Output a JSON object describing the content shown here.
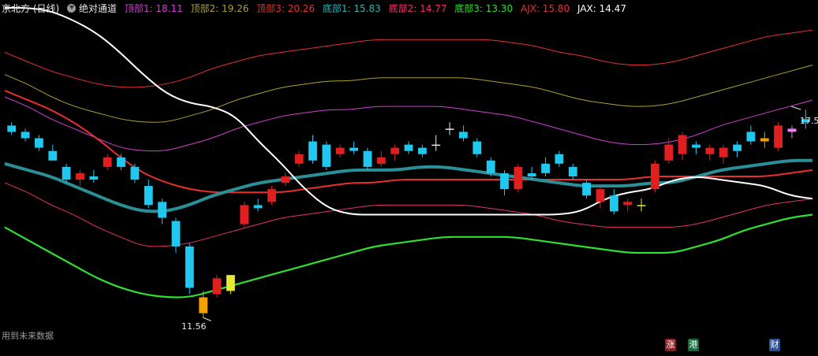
{
  "header": {
    "title": "京北方 (日线)",
    "indicator_name": "绝对通道",
    "items": [
      {
        "label": "顶部1: 18.11",
        "color": "#d040d0"
      },
      {
        "label": "顶部2: 19.26",
        "color": "#b0a030"
      },
      {
        "label": "顶部3: 20.26",
        "color": "#e83030"
      },
      {
        "label": "底部1: 15.83",
        "color": "#30b0b0"
      },
      {
        "label": "底部2: 14.77",
        "color": "#e83070"
      },
      {
        "label": "底部3: 13.30",
        "color": "#30e030"
      },
      {
        "label": "AJX: 15.80",
        "color": "#e83030"
      },
      {
        "label": "JAX: 14.47",
        "color": "#ffffff"
      }
    ]
  },
  "footer_text": "用到未来数据",
  "badges": [
    {
      "text": "涨",
      "color": "#c83030"
    },
    {
      "text": "港",
      "color": "#20a040"
    },
    {
      "text": "财",
      "color": "#3060c0"
    }
  ],
  "annotations": {
    "high": "17.5",
    "low": "11.56"
  },
  "chart_data": {
    "type": "candlestick",
    "ylim": [
      11,
      21
    ],
    "high_label": "17.5",
    "low_label": "11.56",
    "series": [
      {
        "name": "顶部3",
        "color": "#e83030",
        "values": [
          19.9,
          19.6,
          19.3,
          19.1,
          18.9,
          18.8,
          18.8,
          18.9,
          19.1,
          19.4,
          19.6,
          19.8,
          19.9,
          20.0,
          20.1,
          20.2,
          20.3,
          20.3,
          20.3,
          20.3,
          20.3,
          20.3,
          20.2,
          20.1,
          19.9,
          19.8,
          19.6,
          19.5,
          19.5,
          19.6,
          19.8,
          20.0,
          20.2,
          20.4,
          20.5,
          20.6
        ]
      },
      {
        "name": "顶部2",
        "color": "#b0a030",
        "values": [
          19.2,
          18.9,
          18.5,
          18.2,
          18.0,
          17.8,
          17.7,
          17.7,
          17.9,
          18.1,
          18.4,
          18.6,
          18.8,
          18.9,
          19.0,
          19.0,
          19.1,
          19.1,
          19.1,
          19.1,
          19.1,
          19.0,
          18.9,
          18.8,
          18.6,
          18.4,
          18.3,
          18.2,
          18.2,
          18.3,
          18.5,
          18.7,
          18.9,
          19.1,
          19.3,
          19.5
        ]
      },
      {
        "name": "顶部1",
        "color": "#d040d0",
        "values": [
          18.5,
          18.2,
          17.8,
          17.5,
          17.2,
          16.9,
          16.8,
          16.8,
          17.0,
          17.2,
          17.5,
          17.7,
          17.9,
          18.0,
          18.1,
          18.1,
          18.2,
          18.2,
          18.2,
          18.2,
          18.1,
          18.0,
          17.9,
          17.7,
          17.5,
          17.3,
          17.1,
          17.0,
          17.0,
          17.1,
          17.3,
          17.6,
          17.8,
          18.0,
          18.2,
          18.4
        ]
      },
      {
        "name": "AJX",
        "color": "#e83030",
        "values": [
          18.7,
          18.4,
          18.1,
          17.7,
          17.2,
          16.6,
          16.1,
          15.8,
          15.6,
          15.5,
          15.5,
          15.5,
          15.5,
          15.6,
          15.7,
          15.8,
          15.8,
          15.9,
          15.9,
          15.9,
          15.9,
          15.9,
          15.9,
          15.9,
          15.9,
          15.9,
          15.9,
          15.9,
          16.0,
          16.0,
          16.0,
          16.0,
          16.0,
          16.0,
          16.1,
          16.2
        ]
      },
      {
        "name": "底部1",
        "color": "#2b8f98",
        "values": [
          16.4,
          16.2,
          16.0,
          15.7,
          15.4,
          15.1,
          14.9,
          14.9,
          15.1,
          15.4,
          15.6,
          15.8,
          15.9,
          16.0,
          16.1,
          16.2,
          16.2,
          16.2,
          16.3,
          16.3,
          16.2,
          16.1,
          16.0,
          15.9,
          15.8,
          15.7,
          15.7,
          15.7,
          15.8,
          15.8,
          16.0,
          16.2,
          16.3,
          16.4,
          16.5,
          16.5
        ]
      },
      {
        "name": "底部2",
        "color": "#e83070",
        "values": [
          15.8,
          15.5,
          15.1,
          14.8,
          14.4,
          14.1,
          13.8,
          13.8,
          13.9,
          14.1,
          14.3,
          14.5,
          14.7,
          14.8,
          14.9,
          15.0,
          15.1,
          15.1,
          15.1,
          15.1,
          15.1,
          15.0,
          14.9,
          14.8,
          14.6,
          14.5,
          14.4,
          14.4,
          14.4,
          14.4,
          14.5,
          14.7,
          14.9,
          15.1,
          15.2,
          15.3
        ]
      },
      {
        "name": "底部3",
        "color": "#30e030",
        "values": [
          14.4,
          14.0,
          13.6,
          13.2,
          12.8,
          12.5,
          12.3,
          12.2,
          12.2,
          12.4,
          12.6,
          12.8,
          13.0,
          13.2,
          13.4,
          13.6,
          13.8,
          13.9,
          14.0,
          14.1,
          14.1,
          14.1,
          14.1,
          14.0,
          13.9,
          13.8,
          13.7,
          13.6,
          13.6,
          13.6,
          13.8,
          14.0,
          14.3,
          14.5,
          14.7,
          14.8
        ]
      },
      {
        "name": "JAX",
        "color": "#ffffff",
        "values": [
          21.3,
          21.3,
          21.2,
          20.9,
          20.5,
          19.9,
          19.2,
          18.6,
          18.3,
          18.2,
          17.9,
          17.1,
          16.4,
          15.6,
          15.0,
          14.8,
          14.8,
          14.8,
          14.8,
          14.8,
          14.8,
          14.8,
          14.8,
          14.8,
          14.8,
          14.9,
          15.3,
          15.5,
          15.6,
          15.9,
          16.0,
          15.9,
          15.8,
          15.7,
          15.4,
          15.3
        ]
      }
    ],
    "candles": [
      [
        17.6,
        17.4,
        17.7,
        17.3
      ],
      [
        17.4,
        17.2,
        17.5,
        17.1
      ],
      [
        17.2,
        16.9,
        17.3,
        16.8
      ],
      [
        16.8,
        16.5,
        17.0,
        16.5
      ],
      [
        16.3,
        15.9,
        16.4,
        15.8
      ],
      [
        15.9,
        16.1,
        16.2,
        15.7
      ],
      [
        16.0,
        15.9,
        16.2,
        15.8
      ],
      [
        16.3,
        16.6,
        16.7,
        16.2
      ],
      [
        16.6,
        16.3,
        16.7,
        16.2
      ],
      [
        16.3,
        15.9,
        16.4,
        15.8
      ],
      [
        15.7,
        15.1,
        15.9,
        15.0
      ],
      [
        15.2,
        14.7,
        15.3,
        14.5
      ],
      [
        14.6,
        13.8,
        14.7,
        13.6
      ],
      [
        13.8,
        12.5,
        13.9,
        12.3
      ],
      [
        12.2,
        11.7,
        12.4,
        11.56
      ],
      [
        12.3,
        12.8,
        12.9,
        12.2
      ],
      [
        12.4,
        12.9,
        12.9,
        12.3
      ],
      [
        14.5,
        15.1,
        15.2,
        14.4
      ],
      [
        15.1,
        15.0,
        15.3,
        14.9
      ],
      [
        15.2,
        15.6,
        15.7,
        15.1
      ],
      [
        15.8,
        16.0,
        16.1,
        15.7
      ],
      [
        16.4,
        16.7,
        16.8,
        16.3
      ],
      [
        17.1,
        16.5,
        17.3,
        16.4
      ],
      [
        17.0,
        16.3,
        17.1,
        16.2
      ],
      [
        16.7,
        16.9,
        17.0,
        16.6
      ],
      [
        16.9,
        16.8,
        17.1,
        16.7
      ],
      [
        16.8,
        16.3,
        16.9,
        16.2
      ],
      [
        16.4,
        16.6,
        16.8,
        16.3
      ],
      [
        16.7,
        16.9,
        17.0,
        16.5
      ],
      [
        17.0,
        16.8,
        17.1,
        16.7
      ],
      [
        16.9,
        16.7,
        17.0,
        16.6
      ],
      [
        17.0,
        17.0,
        17.3,
        16.8
      ],
      [
        17.5,
        17.5,
        17.7,
        17.3
      ],
      [
        17.4,
        17.2,
        17.6,
        17.1
      ],
      [
        17.1,
        16.7,
        17.2,
        16.6
      ],
      [
        16.5,
        16.1,
        16.6,
        16.0
      ],
      [
        16.1,
        15.6,
        16.2,
        15.4
      ],
      [
        15.6,
        16.3,
        16.4,
        15.5
      ],
      [
        16.1,
        16.0,
        16.3,
        15.9
      ],
      [
        16.4,
        16.1,
        16.6,
        16.0
      ],
      [
        16.7,
        16.4,
        16.8,
        16.3
      ],
      [
        16.3,
        16.0,
        16.4,
        15.9
      ],
      [
        15.8,
        15.4,
        15.9,
        15.3
      ],
      [
        15.2,
        15.6,
        15.7,
        15.0
      ],
      [
        15.4,
        14.9,
        15.6,
        14.8
      ],
      [
        15.1,
        15.2,
        15.3,
        14.9
      ],
      [
        15.1,
        15.1,
        15.3,
        14.9
      ],
      [
        15.6,
        16.4,
        16.5,
        15.5
      ],
      [
        16.5,
        17.0,
        17.2,
        16.4
      ],
      [
        16.7,
        17.3,
        17.4,
        16.5
      ],
      [
        17.0,
        16.9,
        17.1,
        16.7
      ],
      [
        16.7,
        16.9,
        17.0,
        16.5
      ],
      [
        16.6,
        16.9,
        17.0,
        16.4
      ],
      [
        17.0,
        16.8,
        17.1,
        16.6
      ],
      [
        17.4,
        17.1,
        17.6,
        17.0
      ],
      [
        17.1,
        17.2,
        17.4,
        16.9
      ],
      [
        16.9,
        17.6,
        17.7,
        16.8
      ],
      [
        17.5,
        17.4,
        17.6,
        17.2
      ],
      [
        17.8,
        17.7,
        18.1,
        17.5
      ]
    ]
  }
}
